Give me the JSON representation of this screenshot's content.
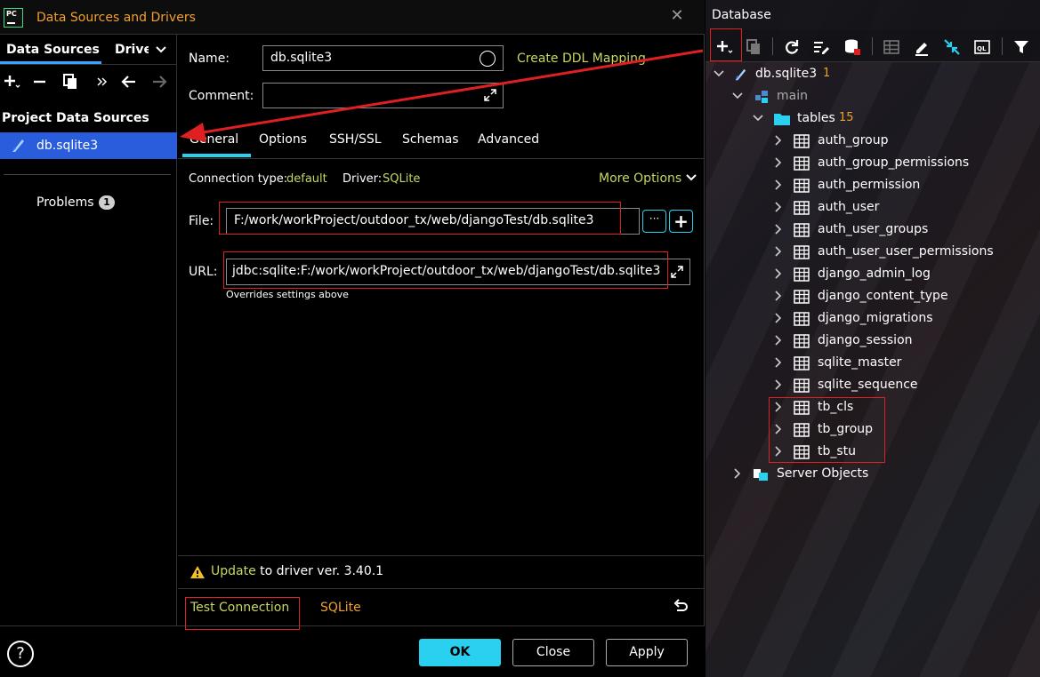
{
  "dialog": {
    "title": "Data Sources and Drivers",
    "left_tabs": [
      "Data Sources",
      "Drive"
    ],
    "project_heading": "Project Data Sources",
    "data_source": "db.sqlite3",
    "problems_label": "Problems",
    "problems_count": "1",
    "name_label": "Name:",
    "name_value": "db.sqlite3",
    "ddl_link": "Create DDL Mapping",
    "comment_label": "Comment:",
    "tabs": [
      "General",
      "Options",
      "SSH/SSL",
      "Schemas",
      "Advanced"
    ],
    "conn_type_label": "Connection type:",
    "conn_type_value": "default",
    "driver_label": "Driver:",
    "driver_value": "SQLite",
    "more_options": "More Options",
    "file_label": "File:",
    "file_value": "F:/work/workProject/outdoor_tx/web/djangoTest/db.sqlite3",
    "file_browse": "···",
    "url_label": "URL:",
    "url_value": "jdbc:sqlite:F:/work/workProject/outdoor_tx/web/djangoTest/db.sqlite3",
    "url_hint": "Overrides settings above",
    "update_link": "Update",
    "update_rest": " to driver ver. 3.40.1",
    "test_connection": "Test Connection",
    "driver_link": "SQLite",
    "help": "?",
    "ok": "OK",
    "close": "Close",
    "apply": "Apply"
  },
  "database": {
    "title": "Database",
    "root": {
      "label": "db.sqlite3",
      "count": "1"
    },
    "schema": "main",
    "tables_folder": {
      "label": "tables",
      "count": "15"
    },
    "tables": [
      "auth_group",
      "auth_group_permissions",
      "auth_permission",
      "auth_user",
      "auth_user_groups",
      "auth_user_user_permissions",
      "django_admin_log",
      "django_content_type",
      "django_migrations",
      "django_session",
      "sqlite_master",
      "sqlite_sequence",
      "tb_cls",
      "tb_group",
      "tb_stu"
    ],
    "server_objects": "Server Objects"
  },
  "colors": {
    "accent_cyan": "#2ad0f0",
    "selection_blue": "#2a5ddb",
    "link_green": "#c8d660",
    "orange": "#f0a030",
    "annotation_red": "#e02020"
  }
}
